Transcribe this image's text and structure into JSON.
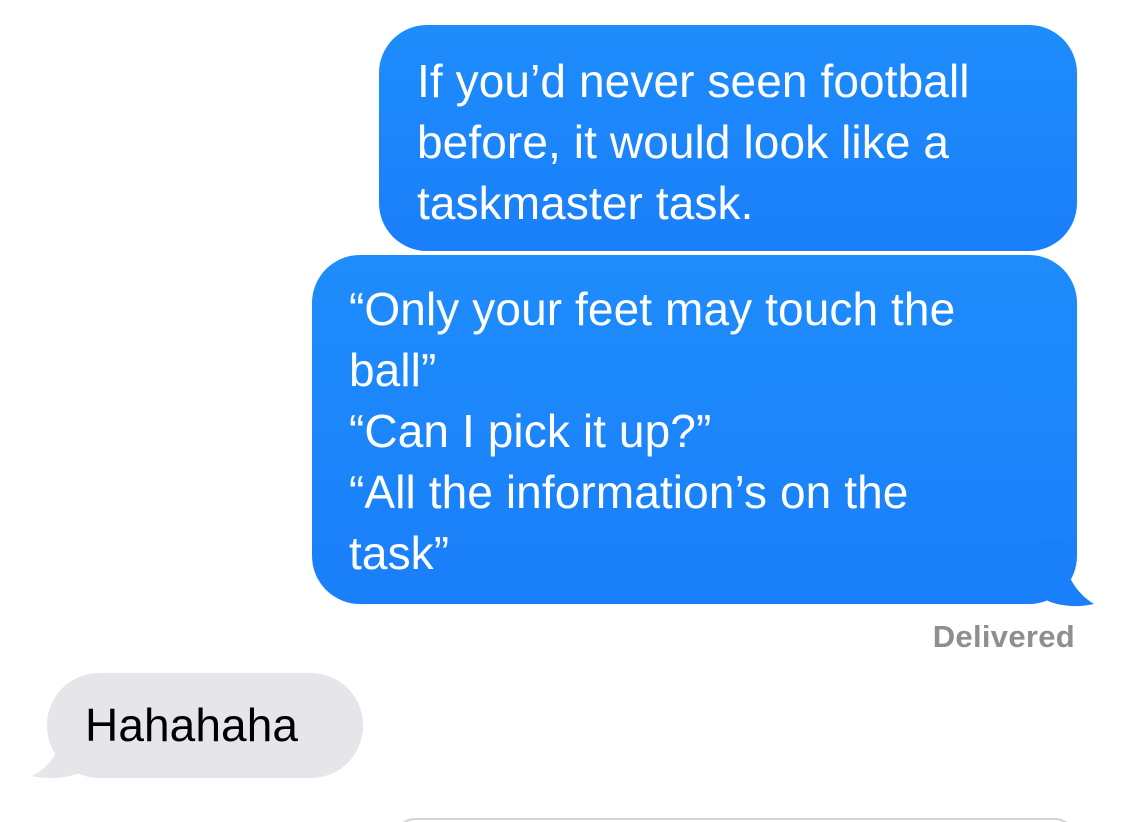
{
  "messages": [
    {
      "direction": "outgoing",
      "text": "If you’d never seen football\nbefore, it would look like a\ntaskmaster task."
    },
    {
      "direction": "outgoing",
      "text": "“Only your feet may touch the\nball”\n“Can I pick it up?”\n“All the information’s on the\ntask”"
    },
    {
      "direction": "incoming",
      "text": "Hahahaha"
    }
  ],
  "status": {
    "delivered_label": "Delivered"
  },
  "colors": {
    "sent_bubble": "#1a82fb",
    "received_bubble": "#e5e5ea",
    "status_text": "#8e8e93"
  }
}
